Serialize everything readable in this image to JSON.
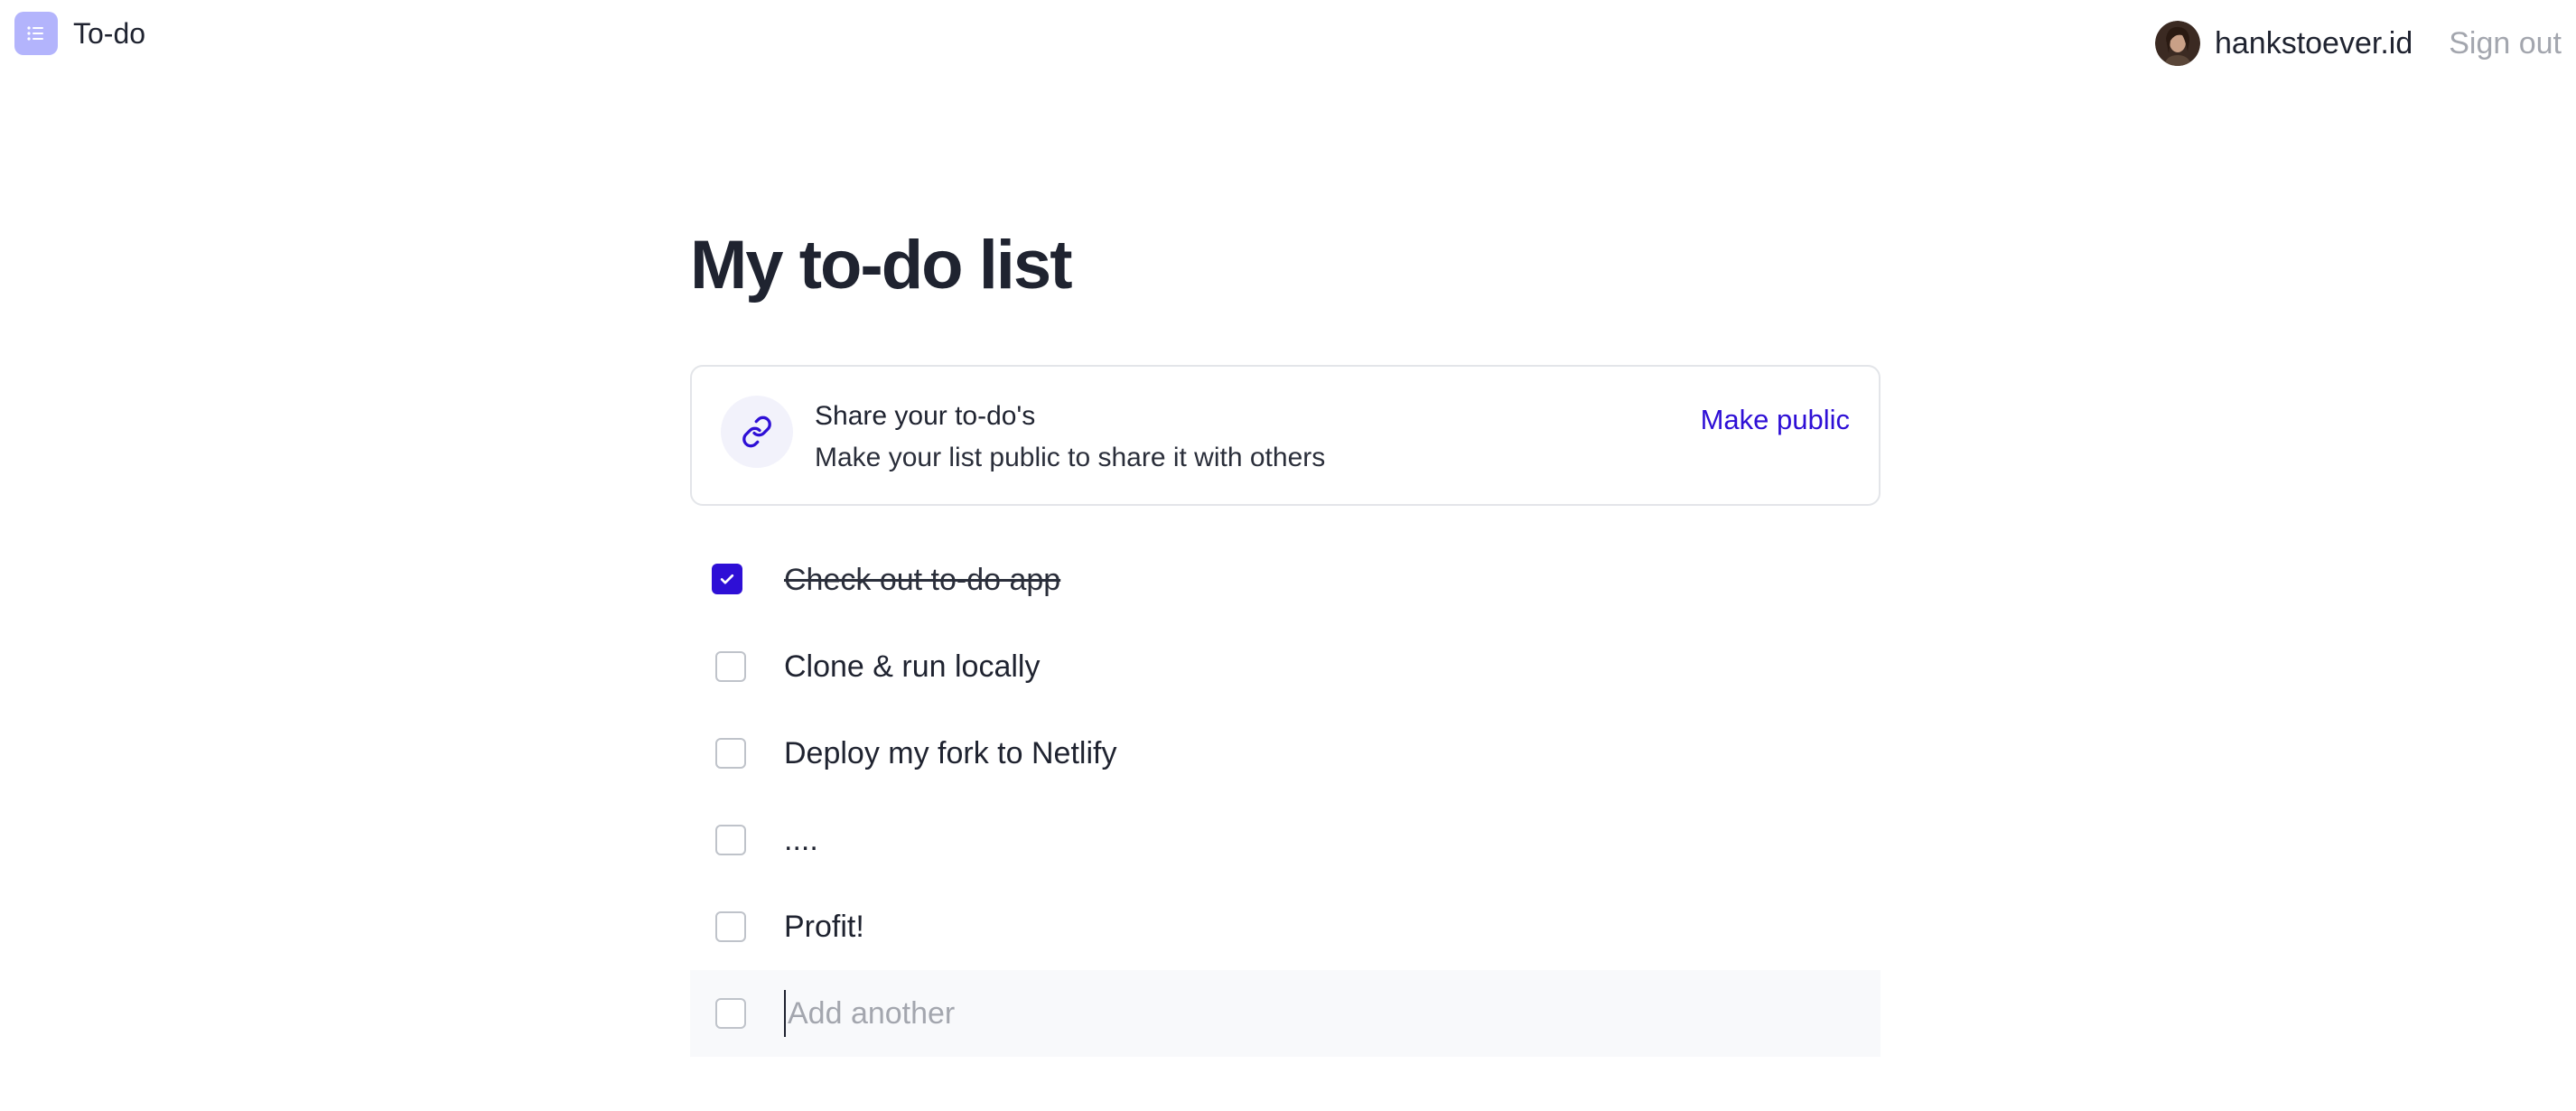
{
  "header": {
    "app_title": "To-do",
    "logo_icon": "list-icon",
    "username": "hankstoever.id",
    "sign_out_label": "Sign out"
  },
  "main": {
    "title": "My to-do list",
    "share_card": {
      "icon": "link-icon",
      "title": "Share your to-do's",
      "description": "Make your list public to share it with others",
      "action_label": "Make public"
    },
    "todos": [
      {
        "text": "Check out to-do app",
        "done": true
      },
      {
        "text": "Clone & run locally",
        "done": false
      },
      {
        "text": "Deploy my fork to Netlify",
        "done": false
      },
      {
        "text": "....",
        "done": false
      },
      {
        "text": "Profit!",
        "done": false
      }
    ],
    "add_placeholder": "Add another"
  },
  "colors": {
    "accent": "#2e0fd6",
    "logo_bg": "#b3b4fc",
    "muted_text": "#a3a6ae",
    "border": "#e3e5e9"
  }
}
